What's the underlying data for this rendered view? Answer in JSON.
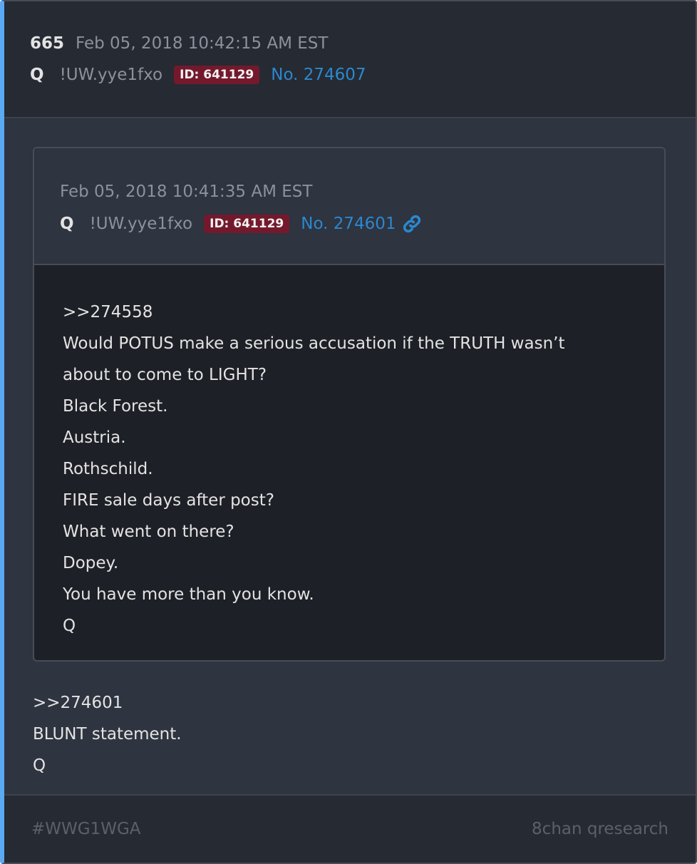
{
  "post": {
    "number": "665",
    "date": "Feb 05, 2018 10:42:15 AM EST",
    "author": "Q",
    "tripcode": "!UW.yye1fxo",
    "id_badge": "ID: 641129",
    "post_no": "No. 274607",
    "body": [
      ">>274601",
      "BLUNT statement.",
      "Q"
    ]
  },
  "quoted_post": {
    "date": "Feb 05, 2018 10:41:35 AM EST",
    "author": "Q",
    "tripcode": "!UW.yye1fxo",
    "id_badge": "ID: 641129",
    "post_no": "No. 274601",
    "link_icon": "link-icon",
    "body": [
      ">>274558",
      "Would POTUS make a serious accusation if the TRUTH wasn’t",
      "about to come to LIGHT?",
      "Black Forest.",
      "Austria.",
      "Rothschild.",
      "FIRE sale days after post?",
      "What went on there?",
      "Dopey.",
      "You have more than you know.",
      "Q"
    ]
  },
  "footer": {
    "hashtag": "#WWG1WGA",
    "source": "8chan qresearch"
  },
  "colors": {
    "accent_border": "#5aa9f2",
    "id_badge_bg": "#74192c",
    "link": "#2b88cf"
  }
}
